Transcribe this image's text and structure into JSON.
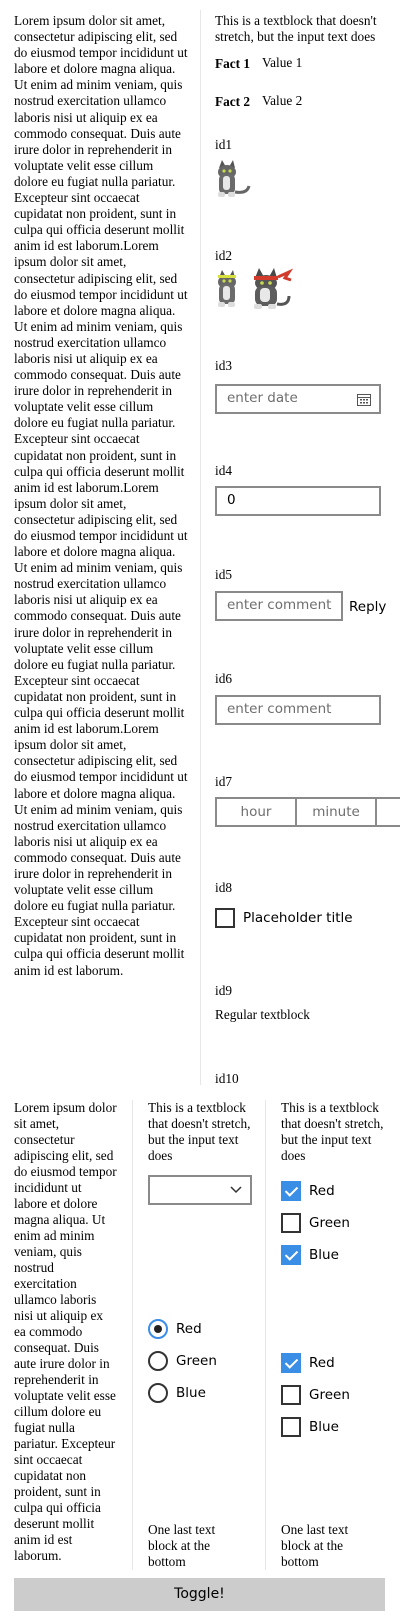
{
  "top": {
    "lorem": "Lorem ipsum dolor sit amet, consectetur adipiscing elit, sed do eiusmod tempor incididunt ut labore et dolore magna aliqua. Ut enim ad minim veniam, quis nostrud exercitation ullamco laboris nisi ut aliquip ex ea commodo consequat. Duis aute irure dolor in reprehenderit in voluptate velit esse cillum dolore eu fugiat nulla pariatur. Excepteur sint occaecat cupidatat non proident, sunt in culpa qui officia deserunt mollit anim id est laborum.Lorem ipsum dolor sit amet, consectetur adipiscing elit, sed do eiusmod tempor incididunt ut labore et dolore magna aliqua. Ut enim ad minim veniam, quis nostrud exercitation ullamco laboris nisi ut aliquip ex ea commodo consequat. Duis aute irure dolor in reprehenderit in voluptate velit esse cillum dolore eu fugiat nulla pariatur. Excepteur sint occaecat cupidatat non proident, sunt in culpa qui officia deserunt mollit anim id est laborum.Lorem ipsum dolor sit amet, consectetur adipiscing elit, sed do eiusmod tempor incididunt ut labore et dolore magna aliqua. Ut enim ad minim veniam, quis nostrud exercitation ullamco laboris nisi ut aliquip ex ea commodo consequat. Duis aute irure dolor in reprehenderit in voluptate velit esse cillum dolore eu fugiat nulla pariatur. Excepteur sint occaecat cupidatat non proident, sunt in culpa qui officia deserunt mollit anim id est laborum.Lorem ipsum dolor sit amet, consectetur adipiscing elit, sed do eiusmod tempor incididunt ut labore et dolore magna aliqua. Ut enim ad minim veniam, quis nostrud exercitation ullamco laboris nisi ut aliquip ex ea commodo consequat. Duis aute irure dolor in reprehenderit in voluptate velit esse cillum dolore eu fugiat nulla pariatur. Excepteur sint occaecat cupidatat non proident, sunt in culpa qui officia deserunt mollit anim id est laborum.",
    "header_line1": "This is a textblock that doesn't",
    "header_line2": "stretch, but the input text does",
    "facts": [
      {
        "title": "Fact 1",
        "value": "Value 1"
      },
      {
        "title": "Fact 2",
        "value": "Value 2"
      }
    ],
    "ids": [
      "id1",
      "id2",
      "id3",
      "id4",
      "id5",
      "id6",
      "id7",
      "id8",
      "id9",
      "id10"
    ],
    "date_placeholder": "enter date",
    "number_value": "0",
    "comment_placeholder": "enter comment",
    "reply_label": "Reply",
    "comment2_placeholder": "enter comment",
    "hour_placeholder": "hour",
    "minute_placeholder": "minute",
    "toggle_title": "Placeholder title",
    "regular_text": "Regular textblock",
    "icons": [
      "calendar-icon",
      "cat-image",
      "ninja-cat-image"
    ]
  },
  "bottom": {
    "lorem": "Lorem ipsum dolor sit amet, consectetur adipiscing elit, sed do eiusmod tempor incididunt ut labore et dolore magna aliqua. Ut enim ad minim veniam, quis nostrud exercitation ullamco laboris nisi ut aliquip ex ea commodo consequat. Duis aute irure dolor in reprehenderit in voluptate velit esse cillum dolore eu fugiat nulla pariatur. Excepteur sint occaecat cupidatat non proident, sunt in culpa qui officia deserunt mollit anim id est laborum.",
    "col2_text": "This is a textblock that doesn't stretch, but the input text does",
    "col3_text": "This is a textblock that doesn't stretch, but the input text does",
    "checks_a": [
      {
        "label": "Red",
        "checked": true
      },
      {
        "label": "Green",
        "checked": false
      },
      {
        "label": "Blue",
        "checked": true
      }
    ],
    "radios": [
      {
        "label": "Red",
        "selected": true
      },
      {
        "label": "Green",
        "selected": false
      },
      {
        "label": "Blue",
        "selected": false
      }
    ],
    "checks_b": [
      {
        "label": "Red",
        "checked": true
      },
      {
        "label": "Green",
        "checked": false
      },
      {
        "label": "Blue",
        "checked": false
      }
    ],
    "last_text": "One last text block at the bottom",
    "toggle_button": "Toggle!"
  },
  "colors": {
    "accent": "#3a8ee6",
    "button_bg": "#cccccc",
    "border": "#8a8a8a"
  }
}
